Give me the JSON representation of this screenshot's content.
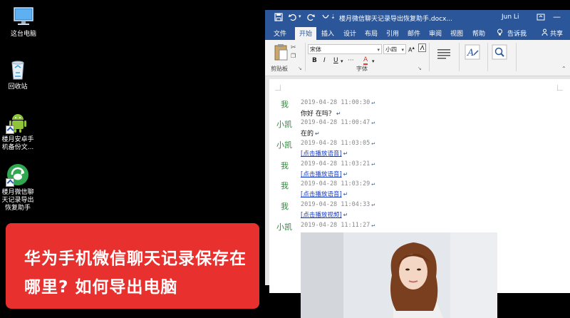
{
  "desktop": {
    "icons": [
      {
        "name": "this-pc",
        "label": "这台电脑"
      },
      {
        "name": "recycle-bin",
        "label": "回收站"
      },
      {
        "name": "android-backup",
        "label": "楼月安卓手\n机备份文..."
      },
      {
        "name": "wechat-export",
        "label": "楼月微信聊\n天记录导出\n恢复助手"
      }
    ]
  },
  "promo": {
    "title": "华为手机微信聊天记录保存在哪里? 如何导出电脑"
  },
  "word": {
    "title": "楼月微信聊天记录导出恢复助手.docx...",
    "user": "Jun Li",
    "tabs": [
      "文件",
      "开始",
      "插入",
      "设计",
      "布局",
      "引用",
      "邮件",
      "审阅",
      "视图",
      "帮助",
      "告诉我",
      "共享"
    ],
    "active_tab": "开始",
    "ribbon": {
      "clipboard_label": "剪贴板",
      "font_label": "字体",
      "font_name": "宋体",
      "font_size": "小四",
      "bold": "B",
      "italic": "I",
      "underline": "U",
      "font_color_letter": "A"
    },
    "messages": [
      {
        "sender": "我",
        "time": "2019-04-28 11:00:30",
        "content": "你好 在吗？",
        "type": "text"
      },
      {
        "sender": "小凯",
        "time": "2019-04-28 11:00:47",
        "content": "在的",
        "type": "text"
      },
      {
        "sender": "小凯",
        "time": "2019-04-28 11:03:05",
        "content": "[点击播放语音]",
        "type": "link"
      },
      {
        "sender": "我",
        "time": "2019-04-28 11:03:21",
        "content": "[点击播放语音]",
        "type": "link"
      },
      {
        "sender": "我",
        "time": "2019-04-28 11:03:29",
        "content": "[点击播放语音]",
        "type": "link"
      },
      {
        "sender": "我",
        "time": "2019-04-28 11:04:33",
        "content": "[点击播放视频]",
        "type": "link"
      },
      {
        "sender": "小凯",
        "time": "2019-04-28 11:11:27",
        "content": "",
        "type": "image"
      }
    ],
    "paragraph_mark": "↵"
  },
  "colors": {
    "word_blue": "#2b579a",
    "promo_red": "#e8312f",
    "sender_green": "#2e8b3a",
    "link_blue": "#1a3ec4"
  }
}
